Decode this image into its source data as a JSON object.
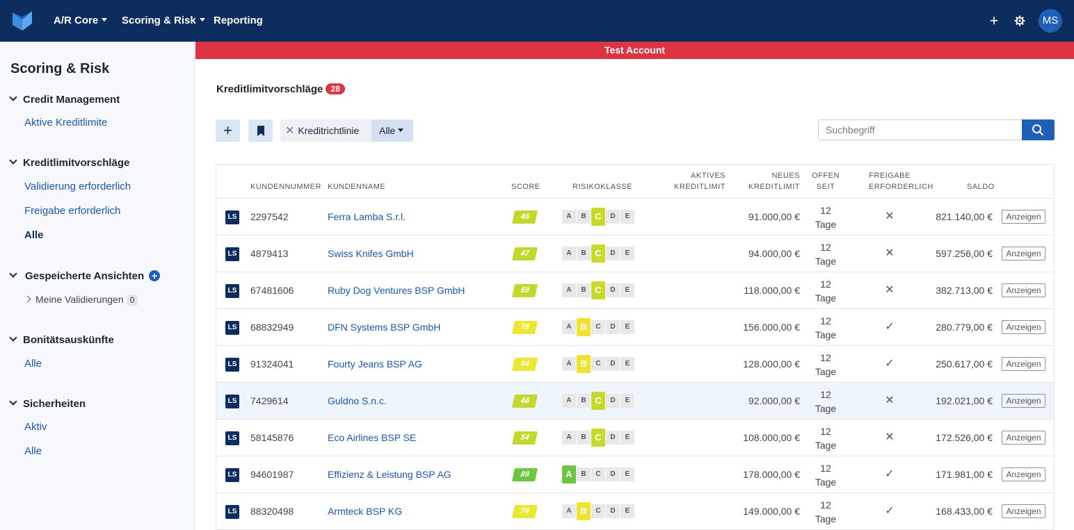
{
  "topbar": {
    "nav": [
      {
        "label": "A/R Core",
        "dropdown": true
      },
      {
        "label": "Scoring & Risk",
        "dropdown": true
      },
      {
        "label": "Reporting",
        "dropdown": false
      }
    ],
    "avatar_initials": "MS",
    "icons": [
      "plus-icon",
      "gear-icon"
    ]
  },
  "banner": {
    "text": "Test Account",
    "color": "#dd3444"
  },
  "sidebar": {
    "title": "Scoring & Risk",
    "sections": [
      {
        "label": "Credit Management",
        "links": [
          "Aktive Kreditlimite"
        ]
      },
      {
        "label": "Kreditlimitvorschläge",
        "links": [
          "Validierung erforderlich",
          "Freigabe erforderlich",
          "Alle"
        ],
        "active": "Alle"
      },
      {
        "label": "Gespeicherte Ansichten",
        "sub": {
          "label": "Meine Validierungen",
          "count": "0"
        }
      },
      {
        "label": "Bonitätsauskünfte",
        "links": [
          "Alle"
        ]
      },
      {
        "label": "Sicherheiten",
        "links": [
          "Aktiv",
          "Alle"
        ]
      }
    ]
  },
  "main": {
    "heading": "Kreditlimitvorschläge",
    "count": "28",
    "filter": {
      "label": "Kreditrichtlinie",
      "value": "Alle"
    },
    "search": {
      "placeholder": "Suchbegriff",
      "value": ""
    }
  },
  "table": {
    "headers": {
      "kundennummer": "KUNDENNUMMER",
      "kundenname": "KUNDENNAME",
      "score": "SCORE",
      "risikoklasse": "RISIKOKLASSE",
      "aktives_1": "AKTIVES",
      "aktives_2": "KREDITLIMIT",
      "neues_1": "NEUES",
      "neues_2": "KREDITLIMIT",
      "offen_1": "OFFEN",
      "offen_2": "SEIT",
      "freigabe_1": "FREIGABE",
      "freigabe_2": "ERFORDERLICH",
      "saldo": "SALDO"
    },
    "risk_classes": [
      "A",
      "B",
      "C",
      "D",
      "E"
    ],
    "risk_colors": {
      "A": "#6cc644",
      "B": "#f1e230",
      "C": "#c7d92b"
    },
    "tag": "LS",
    "days_label": "Tage",
    "action_label": "Anzeigen",
    "rows": [
      {
        "nr": "2297542",
        "name": "Ferra Lamba S.r.l.",
        "score": "46",
        "score_color": "#c3d82e",
        "risk": "C",
        "aktiv": "",
        "neu": "91.000,00 €",
        "offen": "12",
        "freigabe": "✕",
        "saldo": "821.140,00 €"
      },
      {
        "nr": "4879413",
        "name": "Swiss Knifes GmbH",
        "score": "47",
        "score_color": "#c3d82e",
        "risk": "C",
        "aktiv": "",
        "neu": "94.000,00 €",
        "offen": "12",
        "freigabe": "✕",
        "saldo": "597.256,00 €"
      },
      {
        "nr": "67481606",
        "name": "Ruby Dog Ventures BSP GmbH",
        "score": "59",
        "score_color": "#c3d82e",
        "risk": "C",
        "aktiv": "",
        "neu": "118.000,00 €",
        "offen": "12",
        "freigabe": "✕",
        "saldo": "382.713,00 €"
      },
      {
        "nr": "68832949",
        "name": "DFN Systems BSP GmbH",
        "score": "78",
        "score_color": "#ece634",
        "risk": "B",
        "aktiv": "",
        "neu": "156.000,00 €",
        "offen": "12",
        "freigabe": "✓",
        "saldo": "280.779,00 €"
      },
      {
        "nr": "91324041",
        "name": "Fourty Jeans BSP AG",
        "score": "64",
        "score_color": "#ece634",
        "risk": "B",
        "aktiv": "",
        "neu": "128.000,00 €",
        "offen": "12",
        "freigabe": "✓",
        "saldo": "250.617,00 €"
      },
      {
        "nr": "7429614",
        "name": "Guldno S.n.c.",
        "score": "46",
        "score_color": "#c3d82e",
        "risk": "C",
        "aktiv": "",
        "neu": "92.000,00 €",
        "offen": "12",
        "freigabe": "✕",
        "saldo": "192.021,00 €",
        "highlight": true
      },
      {
        "nr": "58145876",
        "name": "Eco Airlines BSP SE",
        "score": "54",
        "score_color": "#c3d82e",
        "risk": "C",
        "aktiv": "",
        "neu": "108.000,00 €",
        "offen": "12",
        "freigabe": "✕",
        "saldo": "172.526,00 €"
      },
      {
        "nr": "94601987",
        "name": "Effizienz & Leistung BSP AG",
        "score": "89",
        "score_color": "#6cc644",
        "risk": "A",
        "aktiv": "",
        "neu": "178.000,00 €",
        "offen": "12",
        "freigabe": "✓",
        "saldo": "171.981,00 €"
      },
      {
        "nr": "88320498",
        "name": "Armteck BSP KG",
        "score": "74",
        "score_color": "#ece634",
        "risk": "B",
        "aktiv": "",
        "neu": "149.000,00 €",
        "offen": "12",
        "freigabe": "✓",
        "saldo": "168.433,00 €"
      }
    ]
  }
}
